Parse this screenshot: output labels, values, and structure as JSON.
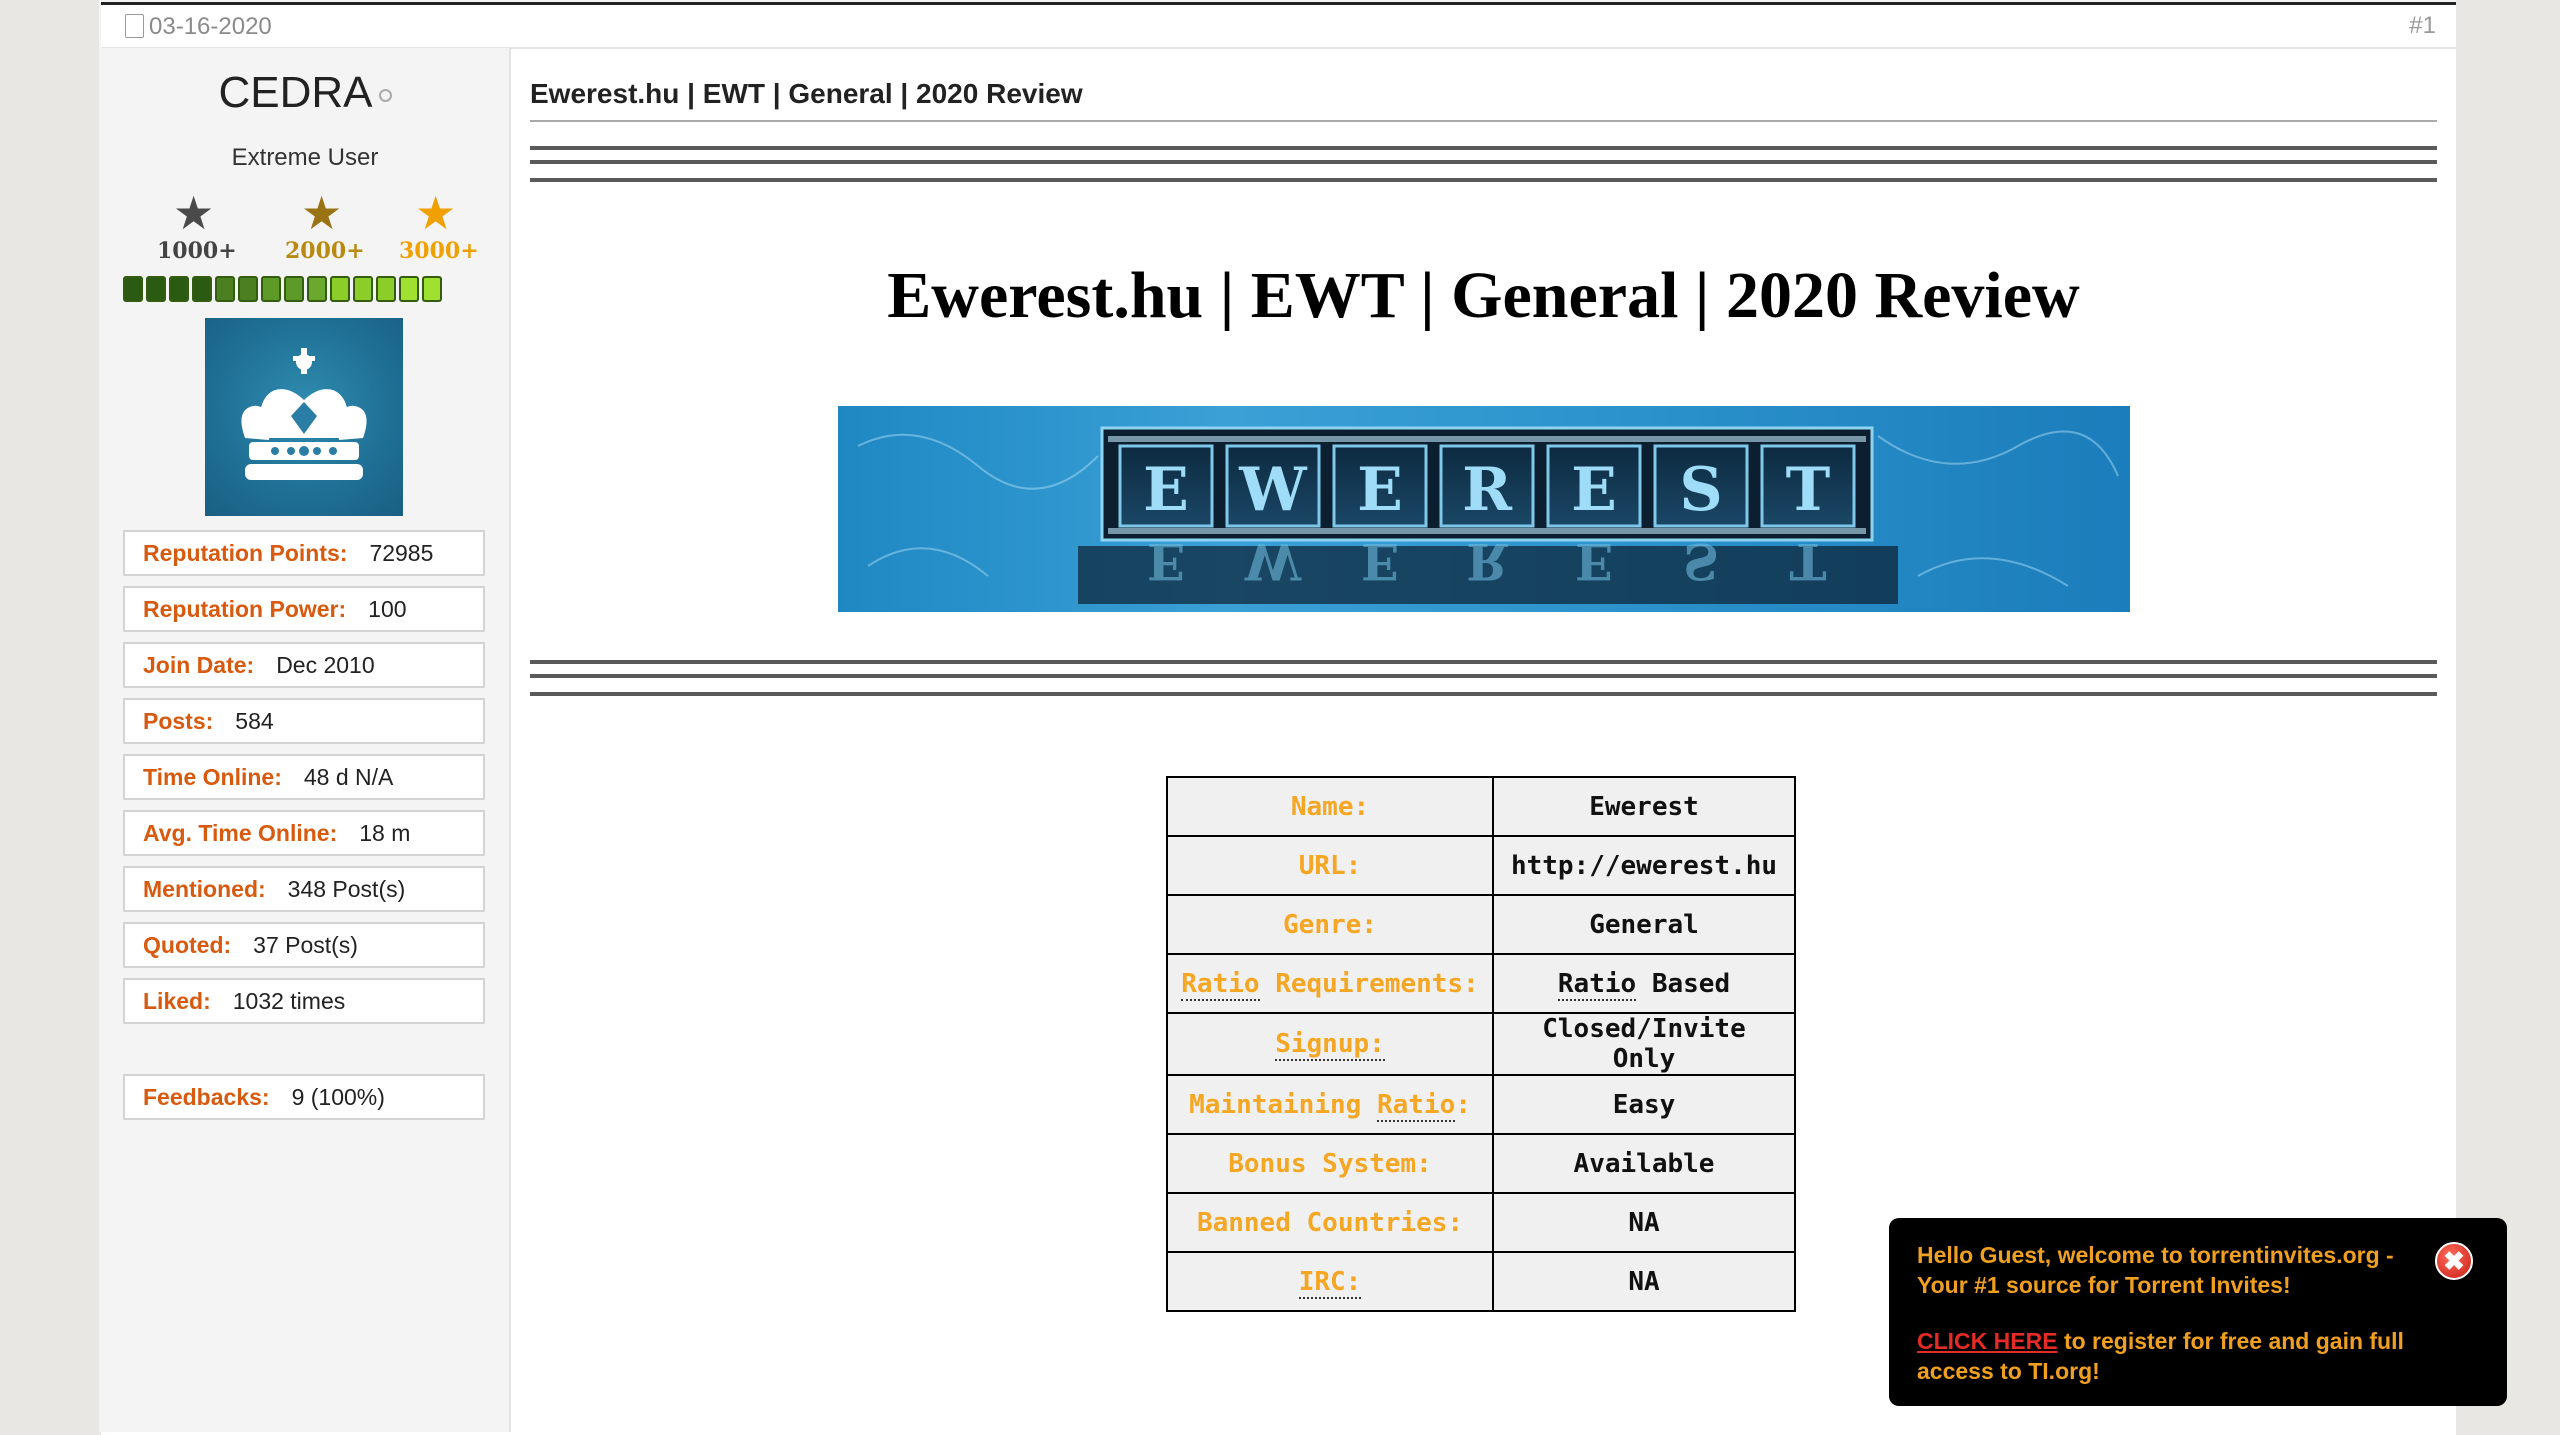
{
  "post": {
    "date": "03-16-2020",
    "number": "#1"
  },
  "user": {
    "name": "CEDRA",
    "title": "Extreme User",
    "stars": [
      {
        "label": "1000+",
        "color": "#555555",
        "label_color": "#555555"
      },
      {
        "label": "2000+",
        "color": "#8a6a1a",
        "label_color": "#b88a10"
      },
      {
        "label": "3000+",
        "color": "#f0a000",
        "label_color": "#f0a000"
      }
    ],
    "reputation_bar_colors": [
      "#2b5b12",
      "#2b5b12",
      "#2b5b12",
      "#2b5b12",
      "#4c7f20",
      "#4c7f20",
      "#5d9a28",
      "#5d9a28",
      "#6aa82e",
      "#8ccd2a",
      "#8ccd2a",
      "#8ccd2a",
      "#9fe030",
      "#9fe030"
    ],
    "stats": [
      {
        "label": "Reputation Points:",
        "value": "72985"
      },
      {
        "label": "Reputation Power:",
        "value": "100"
      },
      {
        "label": "Join Date:",
        "value": "Dec 2010"
      },
      {
        "label": "Posts:",
        "value": "584"
      },
      {
        "label": "Time Online:",
        "value": "48 d N/A"
      },
      {
        "label": "Avg. Time Online:",
        "value": "18 m"
      },
      {
        "label": "Mentioned:",
        "value": "348 Post(s)"
      },
      {
        "label": "Quoted:",
        "value": "37 Post(s)"
      },
      {
        "label": "Liked:",
        "value": "1032 times"
      }
    ],
    "feedback": {
      "label": "Feedbacks:",
      "value": "9 (100%)"
    }
  },
  "content": {
    "title": "Ewerest.hu | EWT | General | 2020 Review",
    "heading": "Ewerest.hu | EWT | General | 2020 Review",
    "banner_letters": [
      "E",
      "W",
      "E",
      "R",
      "E",
      "S",
      "T"
    ],
    "review_rows": [
      {
        "key": "Name:",
        "value": "Ewerest"
      },
      {
        "key": "URL:",
        "value": "http://ewerest.hu"
      },
      {
        "key": "Genre:",
        "value": "General"
      },
      {
        "key_parts": [
          "Ratio",
          " Requirements:"
        ],
        "value_parts": [
          "Ratio",
          " Based"
        ]
      },
      {
        "key": "Signup:",
        "value": "Closed/Invite Only"
      },
      {
        "key_parts": [
          "Maintaining ",
          "Ratio",
          ":"
        ],
        "value": "Easy"
      },
      {
        "key": "Bonus System:",
        "value": "Available"
      },
      {
        "key": "Banned Countries:",
        "value": "NA"
      },
      {
        "key": "IRC:",
        "value": "NA"
      }
    ]
  },
  "toast": {
    "message": "Hello Guest, welcome to torrentinvites.org - Your #1 source for Torrent Invites!",
    "link": "CLICK HERE",
    "message2": " to register for free and gain full access to TI.org!",
    "close_glyph": "✖"
  }
}
